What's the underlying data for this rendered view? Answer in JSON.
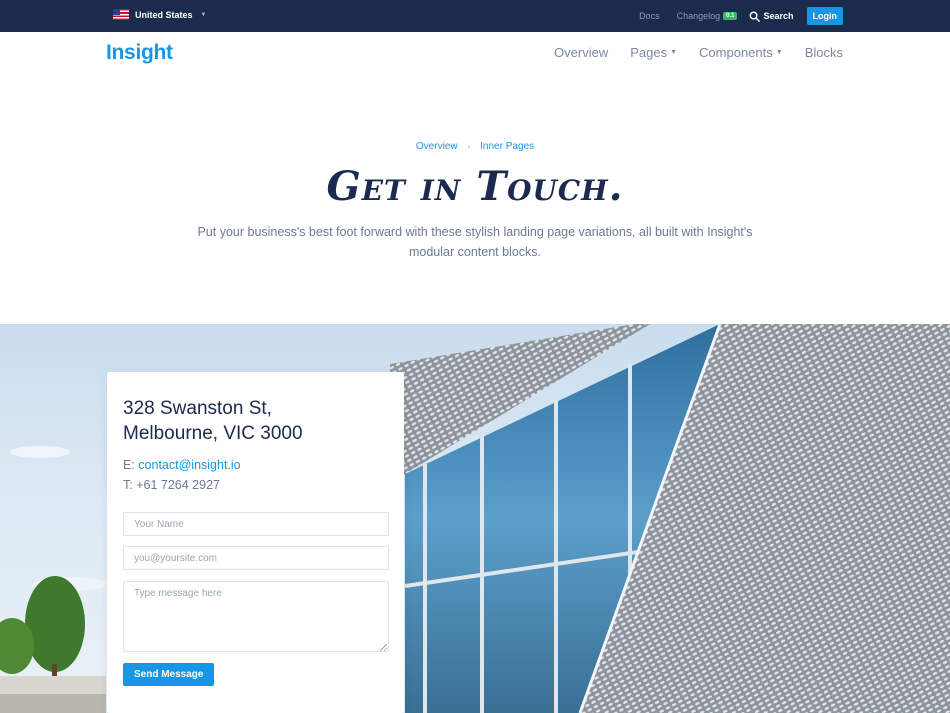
{
  "topbar": {
    "country": "United States",
    "links": {
      "docs": "Docs",
      "changelog": "Changelog",
      "changelog_badge": "0.1",
      "search": "Search",
      "login": "Login"
    }
  },
  "nav": {
    "logo": "Insight",
    "items": [
      {
        "label": "Overview",
        "has_caret": false
      },
      {
        "label": "Pages",
        "has_caret": true
      },
      {
        "label": "Components",
        "has_caret": true
      },
      {
        "label": "Blocks",
        "has_caret": false
      }
    ]
  },
  "hero": {
    "breadcrumb": [
      "Overview",
      "Inner Pages"
    ],
    "title": "Get in Touch.",
    "subtitle": "Put your business's best foot forward with these stylish landing page variations, all built with Insight's modular content blocks."
  },
  "contact": {
    "address_line1": "328 Swanston St,",
    "address_line2": "Melbourne, VIC 3000",
    "email_label": "E:",
    "email": "contact@insight.io",
    "phone_label": "T:",
    "phone": "+61 7264 2927",
    "form": {
      "name_placeholder": "Your Name",
      "email_placeholder": "you@yoursite.com",
      "message_placeholder": "Type message here",
      "submit_label": "Send Message"
    }
  },
  "colors": {
    "primary": "#1796e6",
    "topbar_bg": "#1a2b4c",
    "heading": "#1b2a4e",
    "badge": "#3cba5b"
  }
}
